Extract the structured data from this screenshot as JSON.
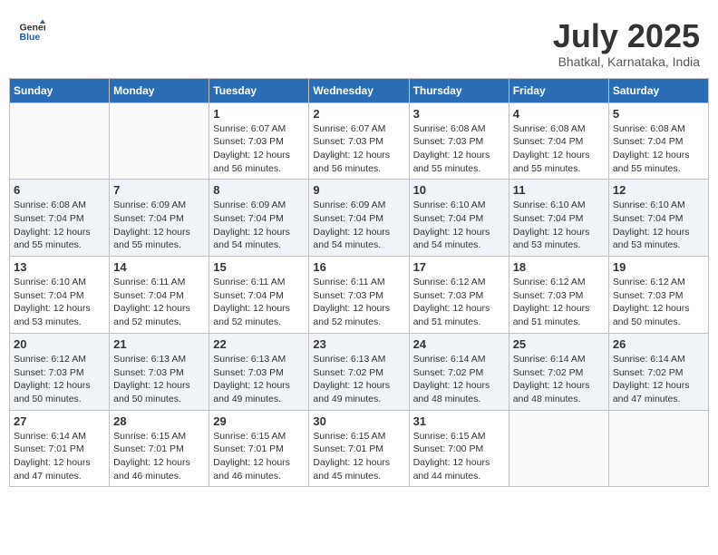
{
  "header": {
    "logo_general": "General",
    "logo_blue": "Blue",
    "month_year": "July 2025",
    "location": "Bhatkal, Karnataka, India"
  },
  "columns": [
    "Sunday",
    "Monday",
    "Tuesday",
    "Wednesday",
    "Thursday",
    "Friday",
    "Saturday"
  ],
  "weeks": [
    [
      {
        "day": "",
        "info": ""
      },
      {
        "day": "",
        "info": ""
      },
      {
        "day": "1",
        "info": "Sunrise: 6:07 AM\nSunset: 7:03 PM\nDaylight: 12 hours and 56 minutes."
      },
      {
        "day": "2",
        "info": "Sunrise: 6:07 AM\nSunset: 7:03 PM\nDaylight: 12 hours and 56 minutes."
      },
      {
        "day": "3",
        "info": "Sunrise: 6:08 AM\nSunset: 7:03 PM\nDaylight: 12 hours and 55 minutes."
      },
      {
        "day": "4",
        "info": "Sunrise: 6:08 AM\nSunset: 7:04 PM\nDaylight: 12 hours and 55 minutes."
      },
      {
        "day": "5",
        "info": "Sunrise: 6:08 AM\nSunset: 7:04 PM\nDaylight: 12 hours and 55 minutes."
      }
    ],
    [
      {
        "day": "6",
        "info": "Sunrise: 6:08 AM\nSunset: 7:04 PM\nDaylight: 12 hours and 55 minutes."
      },
      {
        "day": "7",
        "info": "Sunrise: 6:09 AM\nSunset: 7:04 PM\nDaylight: 12 hours and 55 minutes."
      },
      {
        "day": "8",
        "info": "Sunrise: 6:09 AM\nSunset: 7:04 PM\nDaylight: 12 hours and 54 minutes."
      },
      {
        "day": "9",
        "info": "Sunrise: 6:09 AM\nSunset: 7:04 PM\nDaylight: 12 hours and 54 minutes."
      },
      {
        "day": "10",
        "info": "Sunrise: 6:10 AM\nSunset: 7:04 PM\nDaylight: 12 hours and 54 minutes."
      },
      {
        "day": "11",
        "info": "Sunrise: 6:10 AM\nSunset: 7:04 PM\nDaylight: 12 hours and 53 minutes."
      },
      {
        "day": "12",
        "info": "Sunrise: 6:10 AM\nSunset: 7:04 PM\nDaylight: 12 hours and 53 minutes."
      }
    ],
    [
      {
        "day": "13",
        "info": "Sunrise: 6:10 AM\nSunset: 7:04 PM\nDaylight: 12 hours and 53 minutes."
      },
      {
        "day": "14",
        "info": "Sunrise: 6:11 AM\nSunset: 7:04 PM\nDaylight: 12 hours and 52 minutes."
      },
      {
        "day": "15",
        "info": "Sunrise: 6:11 AM\nSunset: 7:04 PM\nDaylight: 12 hours and 52 minutes."
      },
      {
        "day": "16",
        "info": "Sunrise: 6:11 AM\nSunset: 7:03 PM\nDaylight: 12 hours and 52 minutes."
      },
      {
        "day": "17",
        "info": "Sunrise: 6:12 AM\nSunset: 7:03 PM\nDaylight: 12 hours and 51 minutes."
      },
      {
        "day": "18",
        "info": "Sunrise: 6:12 AM\nSunset: 7:03 PM\nDaylight: 12 hours and 51 minutes."
      },
      {
        "day": "19",
        "info": "Sunrise: 6:12 AM\nSunset: 7:03 PM\nDaylight: 12 hours and 50 minutes."
      }
    ],
    [
      {
        "day": "20",
        "info": "Sunrise: 6:12 AM\nSunset: 7:03 PM\nDaylight: 12 hours and 50 minutes."
      },
      {
        "day": "21",
        "info": "Sunrise: 6:13 AM\nSunset: 7:03 PM\nDaylight: 12 hours and 50 minutes."
      },
      {
        "day": "22",
        "info": "Sunrise: 6:13 AM\nSunset: 7:03 PM\nDaylight: 12 hours and 49 minutes."
      },
      {
        "day": "23",
        "info": "Sunrise: 6:13 AM\nSunset: 7:02 PM\nDaylight: 12 hours and 49 minutes."
      },
      {
        "day": "24",
        "info": "Sunrise: 6:14 AM\nSunset: 7:02 PM\nDaylight: 12 hours and 48 minutes."
      },
      {
        "day": "25",
        "info": "Sunrise: 6:14 AM\nSunset: 7:02 PM\nDaylight: 12 hours and 48 minutes."
      },
      {
        "day": "26",
        "info": "Sunrise: 6:14 AM\nSunset: 7:02 PM\nDaylight: 12 hours and 47 minutes."
      }
    ],
    [
      {
        "day": "27",
        "info": "Sunrise: 6:14 AM\nSunset: 7:01 PM\nDaylight: 12 hours and 47 minutes."
      },
      {
        "day": "28",
        "info": "Sunrise: 6:15 AM\nSunset: 7:01 PM\nDaylight: 12 hours and 46 minutes."
      },
      {
        "day": "29",
        "info": "Sunrise: 6:15 AM\nSunset: 7:01 PM\nDaylight: 12 hours and 46 minutes."
      },
      {
        "day": "30",
        "info": "Sunrise: 6:15 AM\nSunset: 7:01 PM\nDaylight: 12 hours and 45 minutes."
      },
      {
        "day": "31",
        "info": "Sunrise: 6:15 AM\nSunset: 7:00 PM\nDaylight: 12 hours and 44 minutes."
      },
      {
        "day": "",
        "info": ""
      },
      {
        "day": "",
        "info": ""
      }
    ]
  ]
}
